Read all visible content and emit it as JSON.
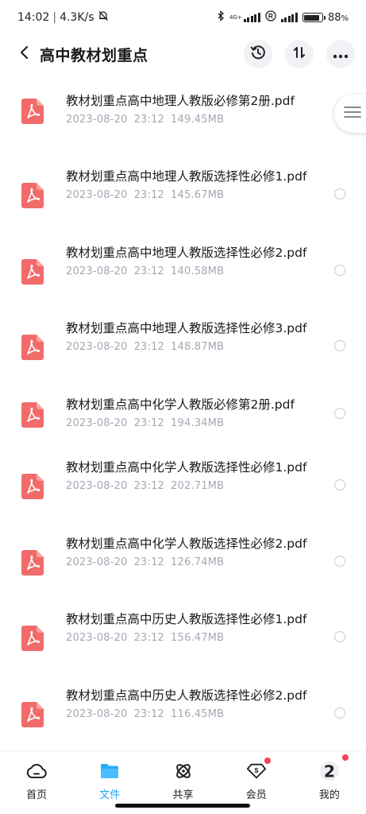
{
  "status_bar": {
    "time": "14:02",
    "net_speed": "4.3K/s",
    "network": "4G+",
    "battery": "88",
    "battery_unit": "%",
    "battery_level": 0.88
  },
  "header": {
    "title": "高中教材划重点"
  },
  "files": [
    {
      "name": "教材划重点高中地理人教版必修第2册.pdf",
      "date": "2023-08-20",
      "time": "23:12",
      "size": "149.45MB"
    },
    {
      "name": "教材划重点高中地理人教版选择性必修1.pdf",
      "date": "2023-08-20",
      "time": "23:12",
      "size": "145.67MB"
    },
    {
      "name": "教材划重点高中地理人教版选择性必修2.pdf",
      "date": "2023-08-20",
      "time": "23:12",
      "size": "140.58MB"
    },
    {
      "name": "教材划重点高中地理人教版选择性必修3.pdf",
      "date": "2023-08-20",
      "time": "23:12",
      "size": "148.87MB"
    },
    {
      "name": "教材划重点高中化学人教版必修第2册.pdf",
      "date": "2023-08-20",
      "time": "23:12",
      "size": "194.34MB"
    },
    {
      "name": "教材划重点高中化学人教版选择性必修1.pdf",
      "date": "2023-08-20",
      "time": "23:12",
      "size": "202.71MB"
    },
    {
      "name": "教材划重点高中化学人教版选择性必修2.pdf",
      "date": "2023-08-20",
      "time": "23:12",
      "size": "126.74MB"
    },
    {
      "name": "教材划重点高中历史人教版选择性必修1.pdf",
      "date": "2023-08-20",
      "time": "23:12",
      "size": "156.47MB"
    },
    {
      "name": "教材划重点高中历史人教版选择性必修2.pdf",
      "date": "2023-08-20",
      "time": "23:12",
      "size": "116.45MB"
    }
  ],
  "bottom_nav": {
    "items": [
      {
        "label": "首页",
        "icon": "cloud-home-icon"
      },
      {
        "label": "文件",
        "icon": "folder-icon",
        "active": true
      },
      {
        "label": "共享",
        "icon": "share-icon"
      },
      {
        "label": "会员",
        "icon": "vip-icon",
        "badge": true
      },
      {
        "label": "我的",
        "icon": "avatar-icon",
        "badge": true
      }
    ]
  },
  "colors": {
    "accent": "#1aa3f7",
    "pdf_red": "#f26b6b",
    "badge_red": "#f2435a",
    "meta_gray": "#a3a8b3"
  }
}
